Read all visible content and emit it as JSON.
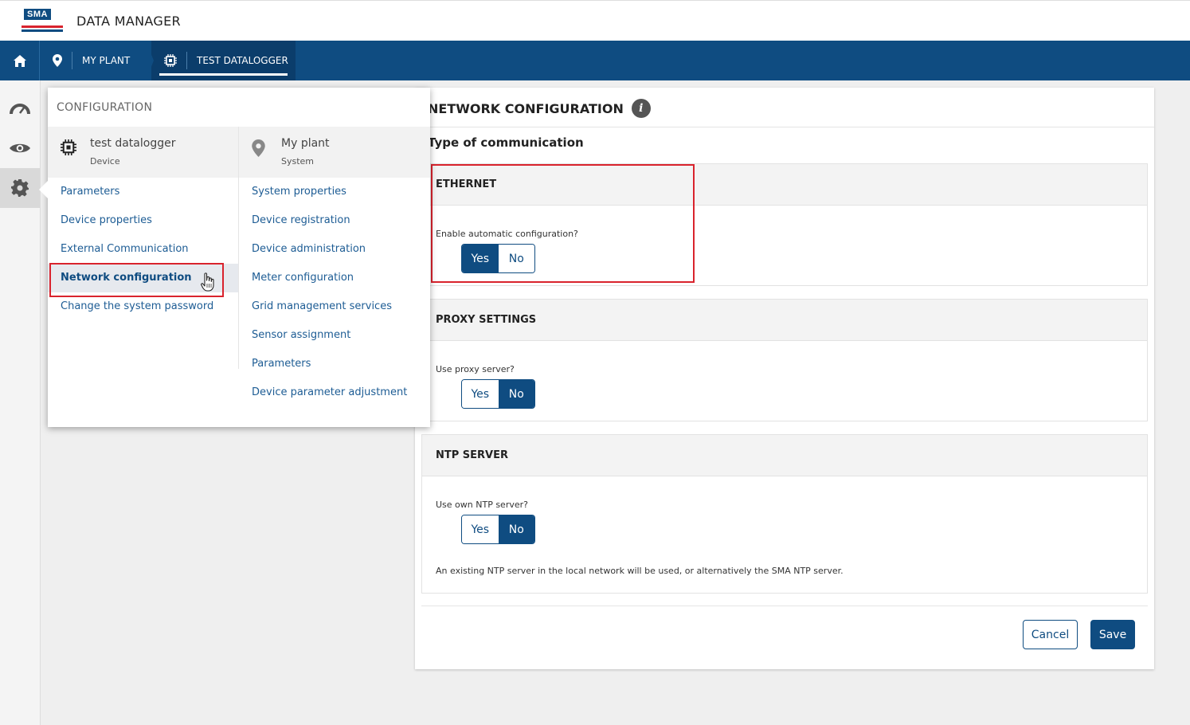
{
  "header": {
    "logo_text": "SMA",
    "app_title": "DATA MANAGER"
  },
  "breadcrumb": {
    "plant_label": "MY PLANT",
    "logger_label": "TEST DATALOGGER"
  },
  "sidebar": {
    "items": [
      "speedometer-icon",
      "eye-icon",
      "gear-icon"
    ]
  },
  "menu": {
    "title": "CONFIGURATION",
    "device": {
      "name": "test datalogger",
      "type": "Device"
    },
    "system": {
      "name": "My plant",
      "type": "System"
    },
    "device_links": [
      "Parameters",
      "Device properties",
      "External Communication",
      "Network configuration",
      "Change the system password"
    ],
    "system_links": [
      "System properties",
      "Device registration",
      "Device administration",
      "Meter configuration",
      "Grid management services",
      "Sensor assignment",
      "Parameters",
      "Device parameter adjustment"
    ]
  },
  "panel": {
    "title": "NETWORK CONFIGURATION",
    "type_of_communication": "Type of communication",
    "ethernet": {
      "heading": "ETHERNET",
      "label": "Enable automatic configuration?",
      "yes": "Yes",
      "no": "No",
      "selected": "Yes"
    },
    "proxy": {
      "heading": "PROXY SETTINGS",
      "label": "Use proxy server?",
      "yes": "Yes",
      "no": "No",
      "selected": "No"
    },
    "ntp": {
      "heading": "NTP SERVER",
      "label": "Use own NTP server?",
      "yes": "Yes",
      "no": "No",
      "selected": "No",
      "note": "An existing NTP server in the local network will be used, or alternatively the SMA NTP server."
    },
    "cancel_label": "Cancel",
    "save_label": "Save"
  },
  "colors": {
    "brand_blue": "#0f4c81",
    "highlight_red": "#d9232d"
  }
}
